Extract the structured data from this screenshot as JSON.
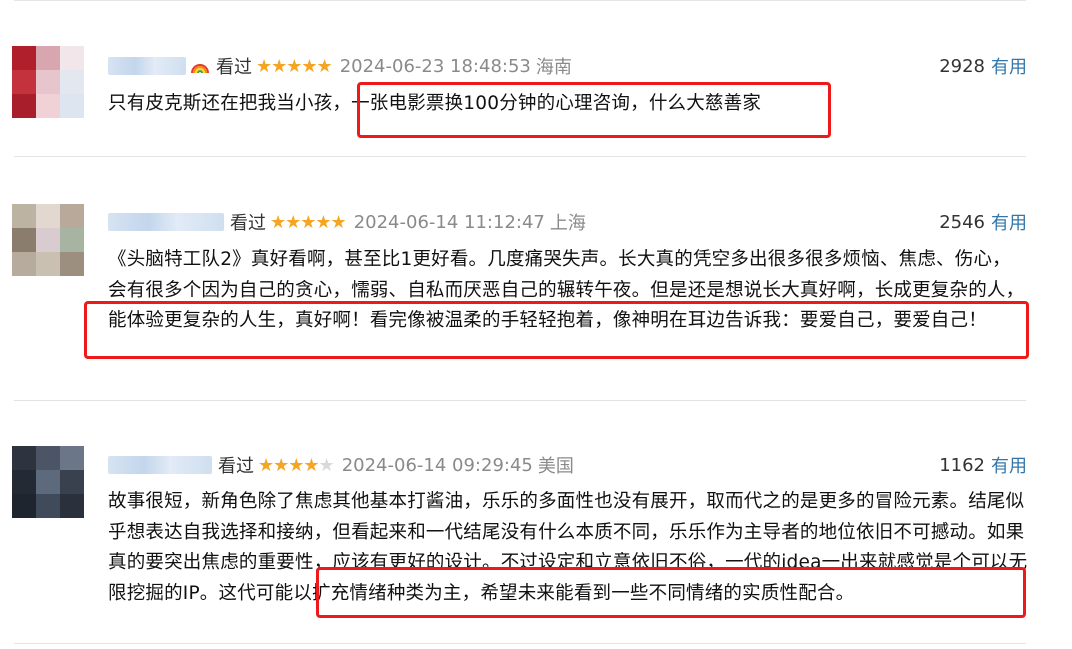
{
  "comments": [
    {
      "watched_label": "看过",
      "rating": 5,
      "stars_filled": "★★★★★",
      "stars_empty": "",
      "date": "2024-06-23 18:48:53",
      "region": "海南",
      "votes": "2928",
      "vote_label": "有用",
      "text": "只有皮克斯还在把我当小孩，一张电影票换100分钟的心理咨询，什么大慈善家"
    },
    {
      "watched_label": "看过",
      "rating": 5,
      "stars_filled": "★★★★★",
      "stars_empty": "",
      "date": "2024-06-14 11:12:47",
      "region": "上海",
      "votes": "2546",
      "vote_label": "有用",
      "text": "《头脑特工队2》真好看啊，甚至比1更好看。几度痛哭失声。长大真的凭空多出很多很多烦恼、焦虑、伤心，会有很多个因为自己的贪心，懦弱、自私而厌恶自己的辗转午夜。但是还是想说长大真好啊，长成更复杂的人，能体验更复杂的人生，真好啊！看完像被温柔的手轻轻抱着，像神明在耳边告诉我：要爱自己，要爱自己！"
    },
    {
      "watched_label": "看过",
      "rating": 4,
      "stars_filled": "★★★★",
      "stars_empty": "★",
      "date": "2024-06-14 09:29:45",
      "region": "美国",
      "votes": "1162",
      "vote_label": "有用",
      "text": "故事很短，新角色除了焦虑其他基本打酱油，乐乐的多面性也没有展开，取而代之的是更多的冒险元素。结尾似乎想表达自我选择和接纳，但看起来和一代结尾没有什么本质不同，乐乐作为主导者的地位依旧不可撼动。如果真的要突出焦虑的重要性，应该有更好的设计。不过设定和立意依旧不俗，一代的idea一出来就感觉是个可以无限挖掘的IP。这代可能以扩充情绪种类为主，希望未来能看到一些不同情绪的实质性配合。"
    }
  ],
  "colors": {
    "highlight": "#ee1a1a",
    "star": "#f6a523",
    "link": "#3377aa",
    "muted": "#8a8a8a"
  },
  "icons": [
    "rainbow-icon",
    "star-icon"
  ]
}
